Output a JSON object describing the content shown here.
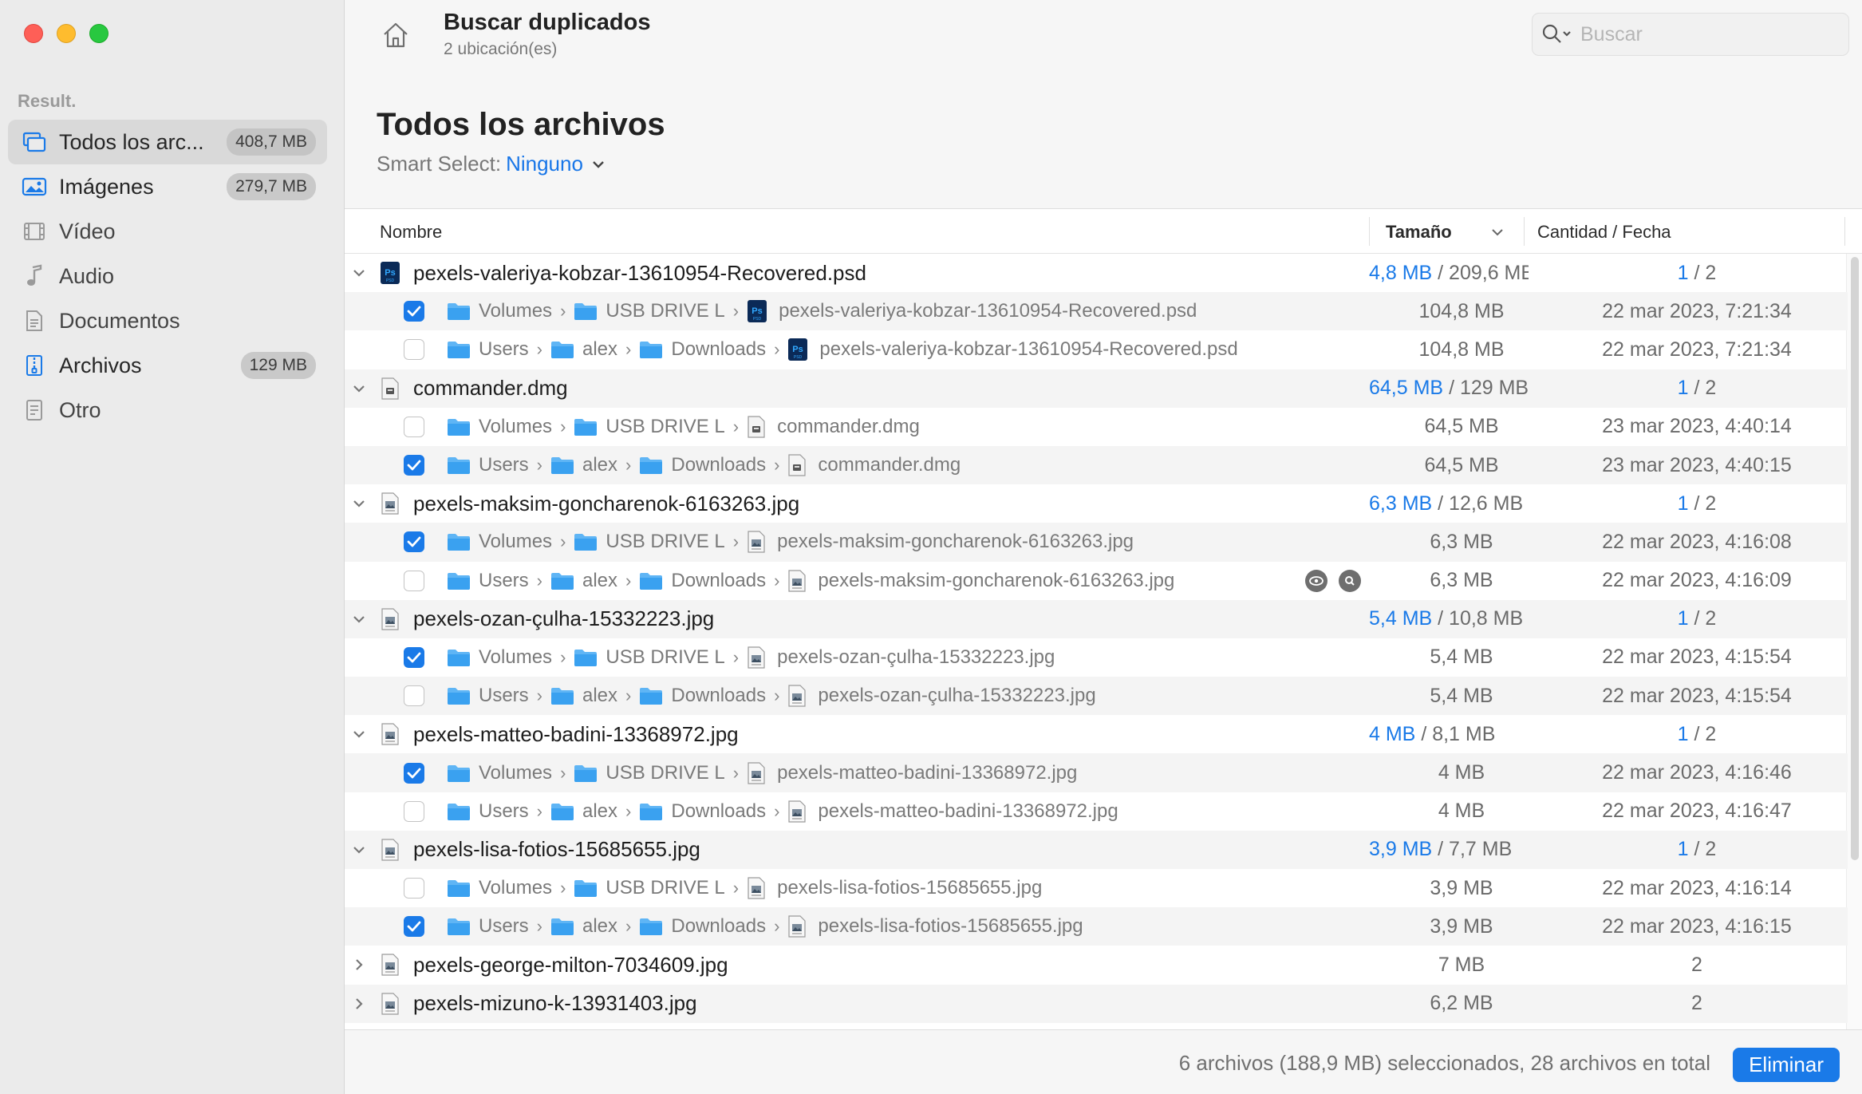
{
  "sidebar": {
    "section_label": "Result.",
    "items": [
      {
        "label": "Todos los arc...",
        "badge": "408,7 MB",
        "icon": "all-files-icon"
      },
      {
        "label": "Imágenes",
        "badge": "279,7 MB",
        "icon": "photo-icon"
      },
      {
        "label": "Vídeo",
        "badge": "",
        "icon": "film-icon"
      },
      {
        "label": "Audio",
        "badge": "",
        "icon": "music-note-icon"
      },
      {
        "label": "Documentos",
        "badge": "",
        "icon": "document-icon"
      },
      {
        "label": "Archivos",
        "badge": "129 MB",
        "icon": "archive-icon"
      },
      {
        "label": "Otro",
        "badge": "",
        "icon": "other-file-icon"
      }
    ]
  },
  "header": {
    "title": "Buscar duplicados",
    "subtitle": "2 ubicación(es)",
    "search_placeholder": "Buscar"
  },
  "main": {
    "title": "Todos los archivos",
    "smart_select_label": "Smart Select:",
    "smart_select_value": "Ninguno"
  },
  "table": {
    "columns": {
      "name": "Nombre",
      "size": "Tamaño",
      "count_date": "Cantidad / Fecha"
    },
    "groups": [
      {
        "name": "pexels-valeriya-kobzar-13610954-Recovered.psd",
        "icon": "psd",
        "size_selected": "4,8 MB",
        "size_total": "/ 209,6 MB",
        "count_selected": "1",
        "count_total": "/ 2",
        "files": [
          {
            "checked": true,
            "path": [
              "Volumes",
              "USB DRIVE L"
            ],
            "filename": "pexels-valeriya-kobzar-13610954-Recovered.psd",
            "size": "104,8 MB",
            "date": "22 mar 2023, 7:21:34"
          },
          {
            "checked": false,
            "path": [
              "Users",
              "alex",
              "Downloads"
            ],
            "filename": "pexels-valeriya-kobzar-13610954-Recovered.psd",
            "size": "104,8 MB",
            "date": "22 mar 2023, 7:21:34"
          }
        ]
      },
      {
        "name": "commander.dmg",
        "icon": "dmg",
        "size_selected": "64,5 MB",
        "size_total": "/ 129 MB",
        "count_selected": "1",
        "count_total": "/ 2",
        "files": [
          {
            "checked": false,
            "path": [
              "Volumes",
              "USB DRIVE L"
            ],
            "filename": "commander.dmg",
            "size": "64,5 MB",
            "date": "23 mar 2023, 4:40:14"
          },
          {
            "checked": true,
            "path": [
              "Users",
              "alex",
              "Downloads"
            ],
            "filename": "commander.dmg",
            "size": "64,5 MB",
            "date": "23 mar 2023, 4:40:15"
          }
        ]
      },
      {
        "name": "pexels-maksim-goncharenok-6163263.jpg",
        "icon": "jpg",
        "size_selected": "6,3 MB",
        "size_total": "/ 12,6 MB",
        "count_selected": "1",
        "count_total": "/ 2",
        "files": [
          {
            "checked": true,
            "path": [
              "Volumes",
              "USB DRIVE L"
            ],
            "filename": "pexels-maksim-goncharenok-6163263.jpg",
            "size": "6,3 MB",
            "date": "22 mar 2023, 4:16:08"
          },
          {
            "checked": false,
            "path": [
              "Users",
              "alex",
              "Downloads"
            ],
            "filename": "pexels-maksim-goncharenok-6163263.jpg",
            "size": "6,3 MB",
            "date": "22 mar 2023, 4:16:09",
            "actions": true
          }
        ]
      },
      {
        "name": "pexels-ozan-çulha-15332223.jpg",
        "icon": "jpg",
        "size_selected": "5,4 MB",
        "size_total": "/ 10,8 MB",
        "count_selected": "1",
        "count_total": "/ 2",
        "files": [
          {
            "checked": true,
            "path": [
              "Volumes",
              "USB DRIVE L"
            ],
            "filename": "pexels-ozan-çulha-15332223.jpg",
            "size": "5,4 MB",
            "date": "22 mar 2023, 4:15:54"
          },
          {
            "checked": false,
            "path": [
              "Users",
              "alex",
              "Downloads"
            ],
            "filename": "pexels-ozan-çulha-15332223.jpg",
            "size": "5,4 MB",
            "date": "22 mar 2023, 4:15:54"
          }
        ]
      },
      {
        "name": "pexels-matteo-badini-13368972.jpg",
        "icon": "jpg",
        "size_selected": "4 MB",
        "size_total": "/ 8,1 MB",
        "count_selected": "1",
        "count_total": "/ 2",
        "files": [
          {
            "checked": true,
            "path": [
              "Volumes",
              "USB DRIVE L"
            ],
            "filename": "pexels-matteo-badini-13368972.jpg",
            "size": "4 MB",
            "date": "22 mar 2023, 4:16:46"
          },
          {
            "checked": false,
            "path": [
              "Users",
              "alex",
              "Downloads"
            ],
            "filename": "pexels-matteo-badini-13368972.jpg",
            "size": "4 MB",
            "date": "22 mar 2023, 4:16:47"
          }
        ]
      },
      {
        "name": "pexels-lisa-fotios-15685655.jpg",
        "icon": "jpg",
        "size_selected": "3,9 MB",
        "size_total": "/ 7,7 MB",
        "count_selected": "1",
        "count_total": "/ 2",
        "files": [
          {
            "checked": false,
            "path": [
              "Volumes",
              "USB DRIVE L"
            ],
            "filename": "pexels-lisa-fotios-15685655.jpg",
            "size": "3,9 MB",
            "date": "22 mar 2023, 4:16:14"
          },
          {
            "checked": true,
            "path": [
              "Users",
              "alex",
              "Downloads"
            ],
            "filename": "pexels-lisa-fotios-15685655.jpg",
            "size": "3,9 MB",
            "date": "22 mar 2023, 4:16:15"
          }
        ]
      }
    ],
    "collapsed_groups": [
      {
        "name": "pexels-george-milton-7034609.jpg",
        "size": "7 MB",
        "count": "2"
      },
      {
        "name": "pexels-mizuno-k-13931403.jpg",
        "size": "6,2 MB",
        "count": "2"
      }
    ]
  },
  "footer": {
    "status": "6 archivos (188,9 MB) seleccionados, 28 archivos en total",
    "delete_label": "Eliminar"
  },
  "colors": {
    "accent": "#1a7ae8",
    "sidebar_bg": "#ebebeb"
  }
}
